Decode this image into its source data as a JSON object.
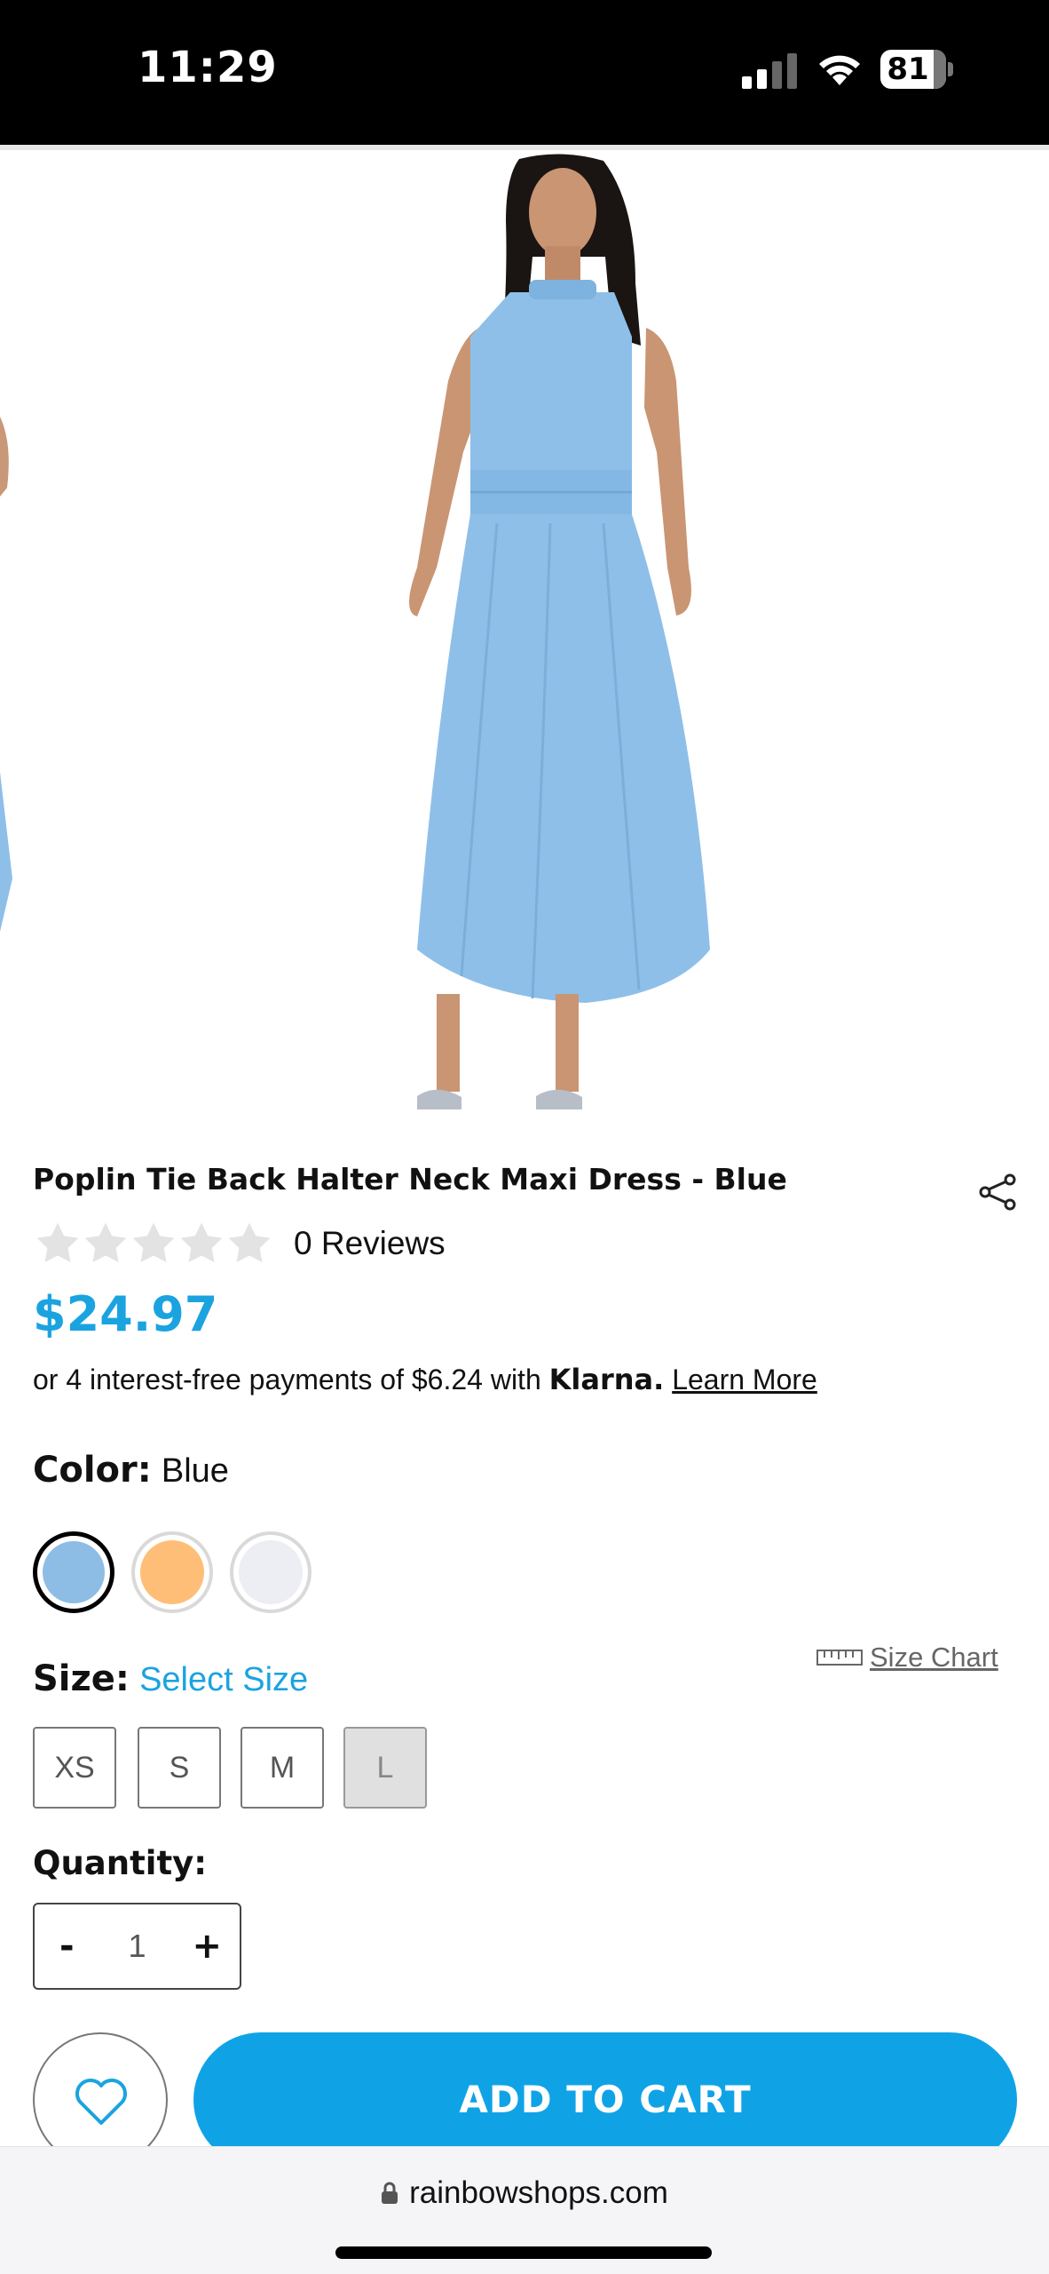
{
  "status_bar": {
    "time": "11:29",
    "battery": "81"
  },
  "product": {
    "title": "Poplin Tie Back Halter Neck Maxi Dress - Blue",
    "rating": 0,
    "reviews": "0 Reviews",
    "price": "$24.97",
    "klarna": {
      "prefix": "or 4 interest-free payments of $6.24 with",
      "brand": "Klarna.",
      "link": "Learn More"
    },
    "color": {
      "label": "Color:",
      "value": "Blue"
    },
    "swatches": [
      {
        "name": "Blue",
        "hex": "#8dbde5",
        "selected": true
      },
      {
        "name": "Orange",
        "hex": "#ffbe78",
        "selected": false
      },
      {
        "name": "White",
        "hex": "#ededf4",
        "selected": false
      }
    ],
    "size": {
      "label": "Size:",
      "prompt": "Select Size",
      "chart_link": "Size Chart",
      "options": [
        "XS",
        "S",
        "M",
        "L"
      ]
    },
    "quantity": {
      "label": "Quantity:",
      "minus": "-",
      "value": "1",
      "plus": "+"
    }
  },
  "actions": {
    "add_to_cart": "ADD TO CART"
  },
  "browser": {
    "url": "rainbowshops.com"
  },
  "colors": {
    "accent": "#1ba3e0",
    "button": "#0fa3e6",
    "dress": "#8ebfe8"
  }
}
